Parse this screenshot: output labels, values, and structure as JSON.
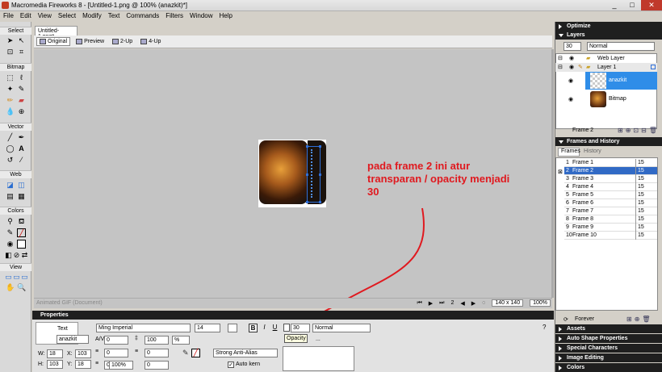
{
  "window": {
    "title": "Macromedia Fireworks 8 - [Untitled-1.png @ 100% (anazkit)*]",
    "minimize": "_",
    "maximize": "□",
    "close": "✕"
  },
  "menu": [
    "File",
    "Edit",
    "View",
    "Select",
    "Modify",
    "Text",
    "Commands",
    "Filters",
    "Window",
    "Help"
  ],
  "tools": {
    "sections": [
      "Select",
      "Bitmap",
      "Vector",
      "Web",
      "Colors",
      "View"
    ]
  },
  "document": {
    "tab": "Untitled-1.png*",
    "views": [
      "Original",
      "Preview",
      "2-Up",
      "4-Up"
    ],
    "status_label": "Animated GIF (Document)",
    "frame": "2",
    "size": "140 x 140",
    "zoom": "100%"
  },
  "annotation": "pada frame 2 ini atur transparan / opacity menjadi 30",
  "properties": {
    "title": "Properties",
    "kind": "Text",
    "name": "anazkit",
    "font": "Ming Imperial",
    "font_size": "14",
    "kerning": "0",
    "leading": "100",
    "leading_unit": "%",
    "indent": "0",
    "space_before": "0",
    "space_after": "0",
    "baseline": "0",
    "scale": "100%",
    "antialias": "Strong Anti-Alias",
    "auto_kern": "Auto kern",
    "opacity": "30",
    "blend": "Normal",
    "tooltip": "Opacity",
    "w_label": "W:",
    "w": "18",
    "x_label": "X:",
    "x": "103",
    "h_label": "H:",
    "h": "103",
    "y_label": "Y:",
    "y": "18",
    "bold": "B",
    "italic": "I",
    "underline": "U",
    "more": "..."
  },
  "right": {
    "optimize": "Optimize",
    "layers_title": "Layers",
    "layer_opacity": "30",
    "layer_blend": "Normal",
    "layers": [
      "Web Layer",
      "Layer 1"
    ],
    "objects": [
      "anazkit",
      "Bitmap"
    ],
    "frame_label": "Frame 2",
    "fh_title": "Frames and History",
    "tabs": [
      "Frames",
      "History"
    ],
    "frames": [
      {
        "n": "1",
        "name": "Frame 1",
        "delay": "15"
      },
      {
        "n": "2",
        "name": "Frame 2",
        "delay": "15"
      },
      {
        "n": "3",
        "name": "Frame 3",
        "delay": "15"
      },
      {
        "n": "4",
        "name": "Frame 4",
        "delay": "15"
      },
      {
        "n": "5",
        "name": "Frame 5",
        "delay": "15"
      },
      {
        "n": "6",
        "name": "Frame 6",
        "delay": "15"
      },
      {
        "n": "7",
        "name": "Frame 7",
        "delay": "15"
      },
      {
        "n": "8",
        "name": "Frame 8",
        "delay": "15"
      },
      {
        "n": "9",
        "name": "Frame 9",
        "delay": "15"
      },
      {
        "n": "10",
        "name": "Frame 10",
        "delay": "15"
      }
    ],
    "loop": "Forever",
    "collapsed": [
      "Assets",
      "Auto Shape Properties",
      "Special Characters",
      "Image Editing",
      "Colors"
    ]
  }
}
